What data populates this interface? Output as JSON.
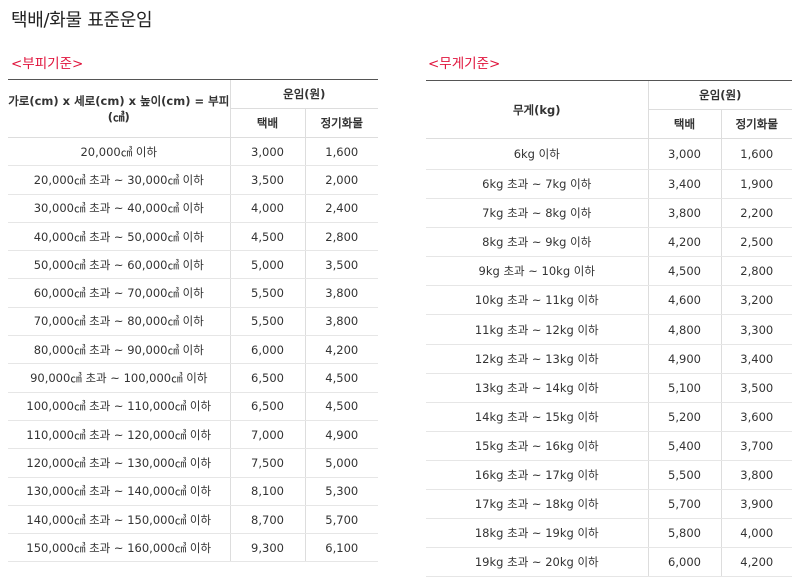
{
  "page": {
    "title": "택배/화물 표준운임"
  },
  "volume": {
    "section_title": "<부피기준>",
    "header_col1": "가로(cm) x 세로(cm) x 높이(cm) = 부피(㎤)",
    "header_fare": "운임(원)",
    "header_parcel": "택배",
    "header_freight": "정기화물",
    "rows": [
      {
        "range": "20,000㎤ 이하",
        "parcel": "3,000",
        "freight": "1,600"
      },
      {
        "range": "20,000㎤ 초과 ~ 30,000㎤ 이하",
        "parcel": "3,500",
        "freight": "2,000"
      },
      {
        "range": "30,000㎤ 초과 ~ 40,000㎤ 이하",
        "parcel": "4,000",
        "freight": "2,400"
      },
      {
        "range": "40,000㎤ 초과 ~ 50,000㎤ 이하",
        "parcel": "4,500",
        "freight": "2,800"
      },
      {
        "range": "50,000㎤ 초과 ~ 60,000㎤ 이하",
        "parcel": "5,000",
        "freight": "3,500"
      },
      {
        "range": "60,000㎤ 초과 ~ 70,000㎤ 이하",
        "parcel": "5,500",
        "freight": "3,800"
      },
      {
        "range": "70,000㎤ 초과 ~ 80,000㎤ 이하",
        "parcel": "5,500",
        "freight": "3,800"
      },
      {
        "range": "80,000㎤ 초과 ~ 90,000㎤ 이하",
        "parcel": "6,000",
        "freight": "4,200"
      },
      {
        "range": "90,000㎤ 초과 ~ 100,000㎤ 이하",
        "parcel": "6,500",
        "freight": "4,500"
      },
      {
        "range": "100,000㎤ 초과 ~ 110,000㎤ 이하",
        "parcel": "6,500",
        "freight": "4,500"
      },
      {
        "range": "110,000㎤ 초과 ~ 120,000㎤ 이하",
        "parcel": "7,000",
        "freight": "4,900"
      },
      {
        "range": "120,000㎤ 초과 ~ 130,000㎤ 이하",
        "parcel": "7,500",
        "freight": "5,000"
      },
      {
        "range": "130,000㎤ 초과 ~ 140,000㎤ 이하",
        "parcel": "8,100",
        "freight": "5,300"
      },
      {
        "range": "140,000㎤ 초과 ~ 150,000㎤ 이하",
        "parcel": "8,700",
        "freight": "5,700"
      },
      {
        "range": "150,000㎤ 초과 ~ 160,000㎤ 이하",
        "parcel": "9,300",
        "freight": "6,100"
      }
    ]
  },
  "weight": {
    "section_title": "<무게기준>",
    "header_col1": "무게(kg)",
    "header_fare": "운임(원)",
    "header_parcel": "택배",
    "header_freight": "정기화물",
    "rows": [
      {
        "range": "6kg 이하",
        "parcel": "3,000",
        "freight": "1,600"
      },
      {
        "range": "6kg 초과 ~ 7kg 이하",
        "parcel": "3,400",
        "freight": "1,900"
      },
      {
        "range": "7kg 초과 ~ 8kg 이하",
        "parcel": "3,800",
        "freight": "2,200"
      },
      {
        "range": "8kg 초과 ~ 9kg 이하",
        "parcel": "4,200",
        "freight": "2,500"
      },
      {
        "range": "9kg 초과 ~ 10kg 이하",
        "parcel": "4,500",
        "freight": "2,800"
      },
      {
        "range": "10kg 초과 ~ 11kg 이하",
        "parcel": "4,600",
        "freight": "3,200"
      },
      {
        "range": "11kg 초과 ~ 12kg 이하",
        "parcel": "4,800",
        "freight": "3,300"
      },
      {
        "range": "12kg 초과 ~ 13kg 이하",
        "parcel": "4,900",
        "freight": "3,400"
      },
      {
        "range": "13kg 초과 ~ 14kg 이하",
        "parcel": "5,100",
        "freight": "3,500"
      },
      {
        "range": "14kg 초과 ~ 15kg 이하",
        "parcel": "5,200",
        "freight": "3,600"
      },
      {
        "range": "15kg 초과 ~ 16kg 이하",
        "parcel": "5,400",
        "freight": "3,700"
      },
      {
        "range": "16kg 초과 ~ 17kg 이하",
        "parcel": "5,500",
        "freight": "3,800"
      },
      {
        "range": "17kg 초과 ~ 18kg 이하",
        "parcel": "5,700",
        "freight": "3,900"
      },
      {
        "range": "18kg 초과 ~ 19kg 이하",
        "parcel": "5,800",
        "freight": "4,000"
      },
      {
        "range": "19kg 초과 ~ 20kg 이하",
        "parcel": "6,000",
        "freight": "4,200"
      }
    ]
  }
}
